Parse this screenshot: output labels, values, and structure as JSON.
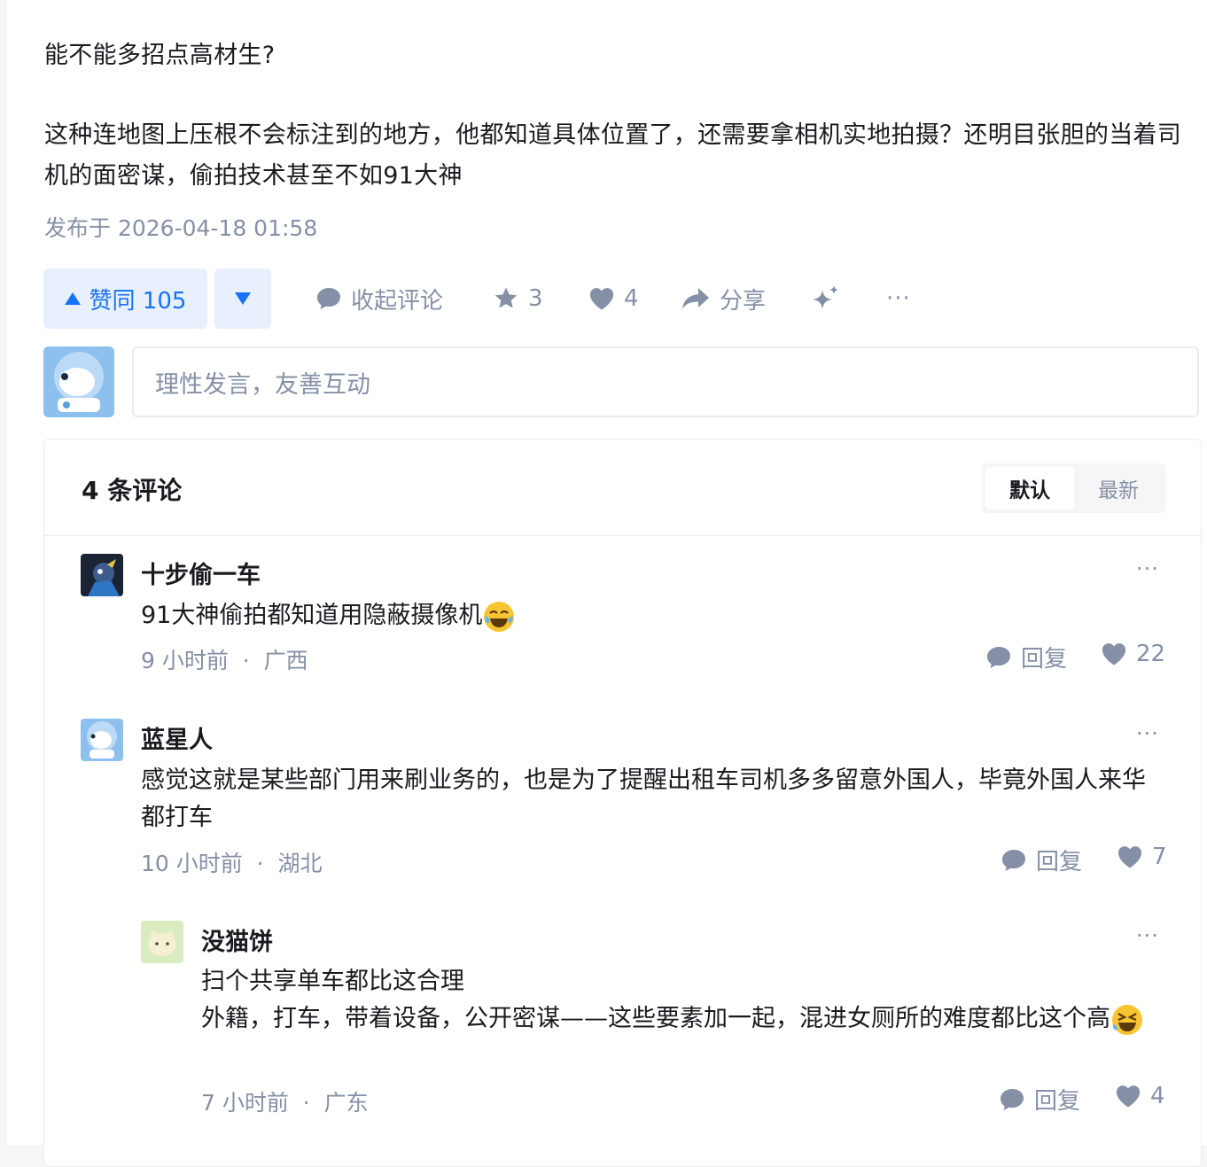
{
  "answer": {
    "paragraph1": "能不能多招点高材生?",
    "paragraph2": "这种连地图上压根不会标注到的地方，他都知道具体位置了，还需要拿相机实地拍摄？还明目张胆的当着司机的面密谋，偷拍技术甚至不如91大神",
    "published": "发布于 2026-04-18 01:58"
  },
  "actions": {
    "upvote_label": "赞同 105",
    "collapse_comments": "收起评论",
    "favorites": "3",
    "likes": "4",
    "share": "分享",
    "more": "···"
  },
  "comment_input": {
    "placeholder": "理性发言，友善互动"
  },
  "comments_section": {
    "title": "4 条评论",
    "sort_default": "默认",
    "sort_latest": "最新",
    "comments": [
      {
        "author": "十步偷一车",
        "text": "91大神偷拍都知道用隐蔽摄像机",
        "time": "9 小时前",
        "location": "广西",
        "reply": "回复",
        "likes": "22"
      },
      {
        "author": "蓝星人",
        "text": "感觉这就是某些部门用来刷业务的，也是为了提醒出租车司机多多留意外国人，毕竟外国人来华都打车",
        "time": "10 小时前",
        "location": "湖北",
        "reply": "回复",
        "likes": "7"
      },
      {
        "author": "没猫饼",
        "text_line1": "扫个共享单车都比这合理",
        "text_line2": "外籍，打车，带着设备，公开密谋——这些要素加一起，混进女厕所的难度都比这个高",
        "time": "7 小时前",
        "location": "广东",
        "reply": "回复",
        "likes": "4"
      }
    ]
  },
  "colors": {
    "brand_blue": "#1772f6",
    "vote_bg": "#e8f0fd",
    "meta_gray": "#8590a6"
  }
}
